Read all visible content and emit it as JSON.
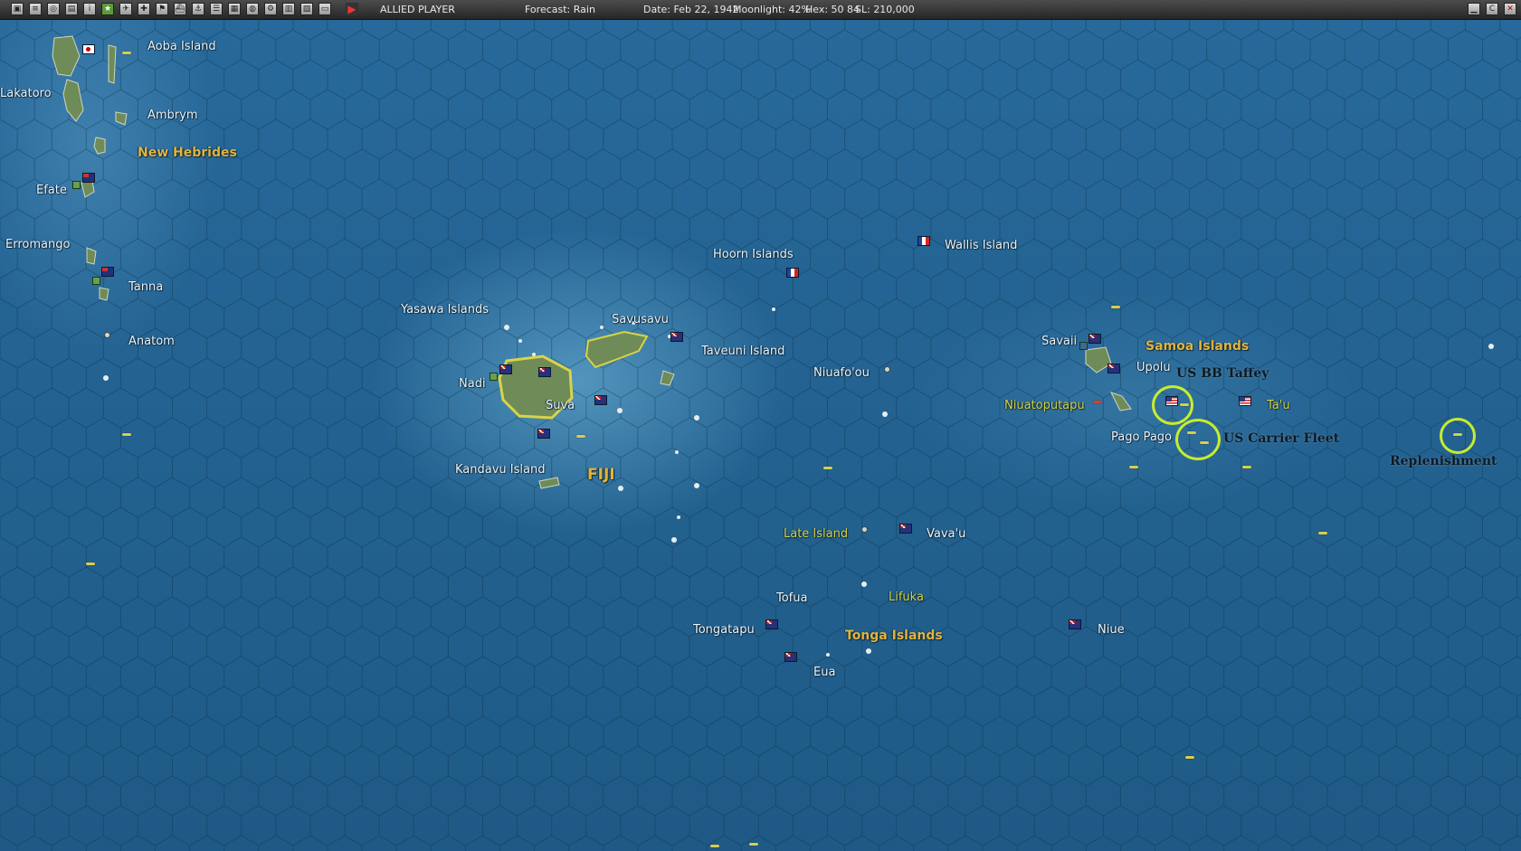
{
  "toolbar": {
    "player": "ALLIED PLAYER",
    "forecast": "Forecast: Rain",
    "date": "Date: Feb 22, 1942",
    "moonlight": "Moonlight: 42%",
    "hex": "Hex: 50 84",
    "sl": "SL: 210,000",
    "buttons": [
      "map-button",
      "report-button",
      "intel-button",
      "save-button",
      "info-button",
      "star-button",
      "air-button",
      "air2-button",
      "flag-button",
      "ship-button",
      "cargo-button",
      "list-button",
      "forces-button",
      "globe-button",
      "settings-button",
      "ob-button",
      "table-button",
      "display-button"
    ],
    "right_buttons": [
      "minimize-button",
      "options-button",
      "close-button"
    ]
  },
  "map": {
    "places": [
      {
        "name": "Aoba Island",
        "style": "normal"
      },
      {
        "name": "Lakatoro",
        "style": "normal"
      },
      {
        "name": "Ambrym",
        "style": "normal"
      },
      {
        "name": "New Hebrides",
        "style": "gold"
      },
      {
        "name": "Efate",
        "style": "normal"
      },
      {
        "name": "Erromango",
        "style": "normal"
      },
      {
        "name": "Tanna",
        "style": "normal"
      },
      {
        "name": "Anatom",
        "style": "normal"
      },
      {
        "name": "Yasawa Islands",
        "style": "normal"
      },
      {
        "name": "Savusavu",
        "style": "normal"
      },
      {
        "name": "Taveuni Island",
        "style": "normal"
      },
      {
        "name": "Nadi",
        "style": "normal"
      },
      {
        "name": "Suva",
        "style": "normal"
      },
      {
        "name": "Kandavu Island",
        "style": "normal"
      },
      {
        "name": "FIJI",
        "style": "big"
      },
      {
        "name": "Hoorn Islands",
        "style": "normal"
      },
      {
        "name": "Wallis Island",
        "style": "normal"
      },
      {
        "name": "Niuafo'ou",
        "style": "normal"
      },
      {
        "name": "Niuatoputapu",
        "style": "yel"
      },
      {
        "name": "Savaii",
        "style": "normal"
      },
      {
        "name": "Samoa Islands",
        "style": "gold"
      },
      {
        "name": "Upolu",
        "style": "normal"
      },
      {
        "name": "Ta'u",
        "style": "yel"
      },
      {
        "name": "Pago Pago",
        "style": "normal"
      },
      {
        "name": "Late Island",
        "style": "yel"
      },
      {
        "name": "Vava'u",
        "style": "normal"
      },
      {
        "name": "Tofua",
        "style": "normal"
      },
      {
        "name": "Lifuka",
        "style": "yel"
      },
      {
        "name": "Tongatapu",
        "style": "normal"
      },
      {
        "name": "Tonga Islands",
        "style": "gold"
      },
      {
        "name": "Eua",
        "style": "normal"
      },
      {
        "name": "Niue",
        "style": "normal"
      }
    ],
    "annotations": [
      "US BB Taffey",
      "US Carrier Fleet",
      "Replenishment"
    ],
    "colors": {
      "ring": "#c7ec2e",
      "ship": "#d6cf4f",
      "land": "#6c8a55",
      "coast": "#d9d347"
    }
  }
}
